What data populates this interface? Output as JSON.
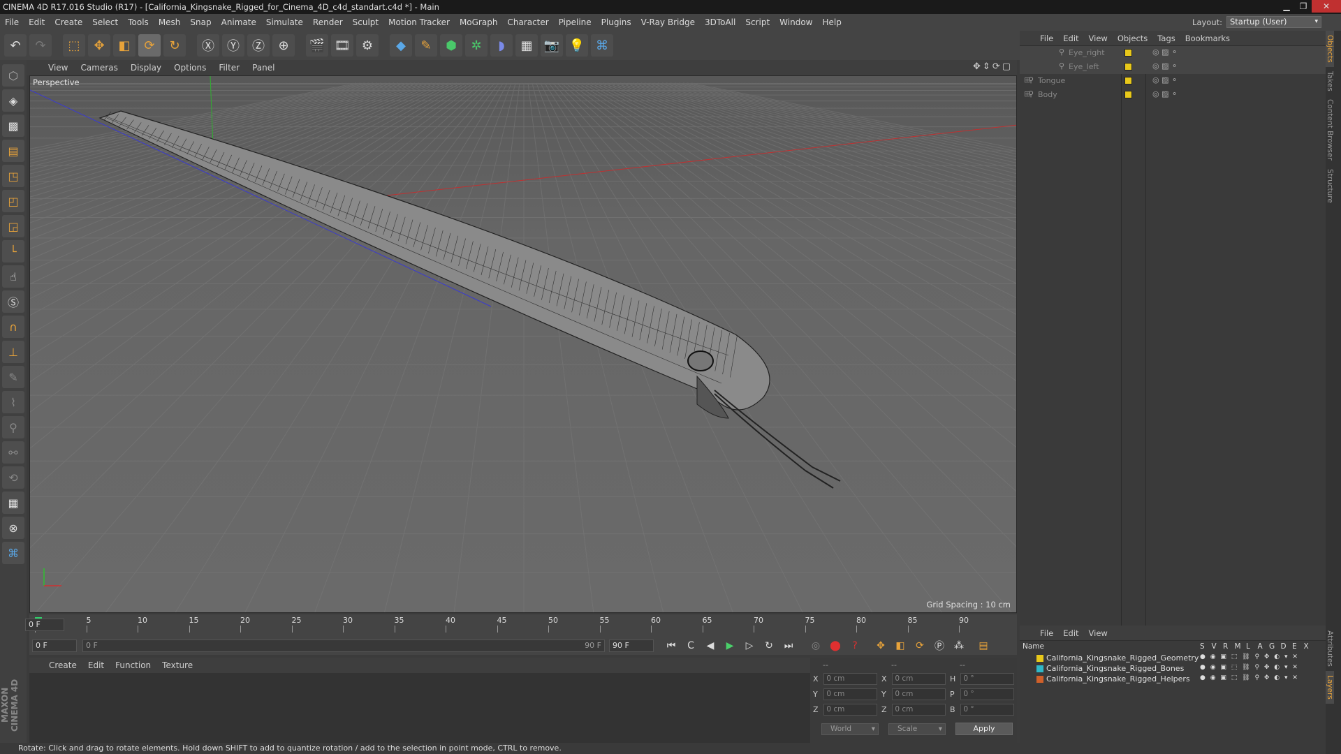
{
  "title": "CINEMA 4D R17.016 Studio (R17) - [California_Kingsnake_Rigged_for_Cinema_4D_c4d_standart.c4d *] - Main",
  "menu": [
    "File",
    "Edit",
    "Create",
    "Select",
    "Tools",
    "Mesh",
    "Snap",
    "Animate",
    "Simulate",
    "Render",
    "Sculpt",
    "Motion Tracker",
    "MoGraph",
    "Character",
    "Pipeline",
    "Plugins",
    "V-Ray Bridge",
    "3DToAll",
    "Script",
    "Window",
    "Help"
  ],
  "layout": {
    "label": "Layout:",
    "value": "Startup (User)"
  },
  "viewport": {
    "menu": [
      "View",
      "Cameras",
      "Display",
      "Options",
      "Filter",
      "Panel"
    ],
    "label": "Perspective",
    "grid_spacing": "Grid Spacing : 10 cm"
  },
  "timeline": {
    "ticks": [
      "0",
      "5",
      "10",
      "15",
      "20",
      "25",
      "30",
      "35",
      "40",
      "45",
      "50",
      "55",
      "60",
      "65",
      "70",
      "75",
      "80",
      "85",
      "90"
    ],
    "end_frame": "0 F",
    "start_field": "0 F",
    "range_start": "0 F",
    "range_end": "90 F",
    "end_field": "90 F"
  },
  "material_menu": [
    "Create",
    "Edit",
    "Function",
    "Texture"
  ],
  "coords": {
    "header": [
      "--",
      "--",
      "--"
    ],
    "rows": [
      {
        "a": "X",
        "av": "0 cm",
        "b": "X",
        "bv": "0 cm",
        "c": "H",
        "cv": "0 °"
      },
      {
        "a": "Y",
        "av": "0 cm",
        "b": "Y",
        "bv": "0 cm",
        "c": "P",
        "cv": "0 °"
      },
      {
        "a": "Z",
        "av": "0 cm",
        "b": "Z",
        "bv": "0 cm",
        "c": "B",
        "cv": "0 °"
      }
    ],
    "world": "World",
    "scale": "Scale",
    "apply": "Apply"
  },
  "status": "Rotate: Click and drag to rotate elements. Hold down SHIFT to add to quantize rotation / add to the selection in point mode, CTRL to remove.",
  "objects_menu": [
    "File",
    "Edit",
    "View",
    "Objects",
    "Tags",
    "Bookmarks"
  ],
  "objects": [
    {
      "name": "Eye_right"
    },
    {
      "name": "Eye_left"
    },
    {
      "name": "Tongue"
    },
    {
      "name": "Body"
    }
  ],
  "layers_menu": [
    "File",
    "Edit",
    "View"
  ],
  "layers_header": {
    "name": "Name",
    "cols": [
      "S",
      "V",
      "R",
      "M",
      "L",
      "A",
      "G",
      "D",
      "E",
      "X"
    ]
  },
  "layers": [
    {
      "name": "California_Kingsnake_Rigged_Geometry",
      "color": "#e8c81a"
    },
    {
      "name": "California_Kingsnake_Rigged_Bones",
      "color": "#2fb8c8"
    },
    {
      "name": "California_Kingsnake_Rigged_Helpers",
      "color": "#d0602a"
    }
  ],
  "side_tabs": [
    "Objects",
    "Takes",
    "Content Browser",
    "Structure",
    "Attributes",
    "Layers"
  ],
  "maxon": "MAXON CINEMA 4D",
  "colors": {
    "accent": "#e8a33a",
    "layer_geometry": "#e8c81a",
    "layer_bones": "#2fb8c8",
    "layer_helpers": "#d0602a"
  }
}
